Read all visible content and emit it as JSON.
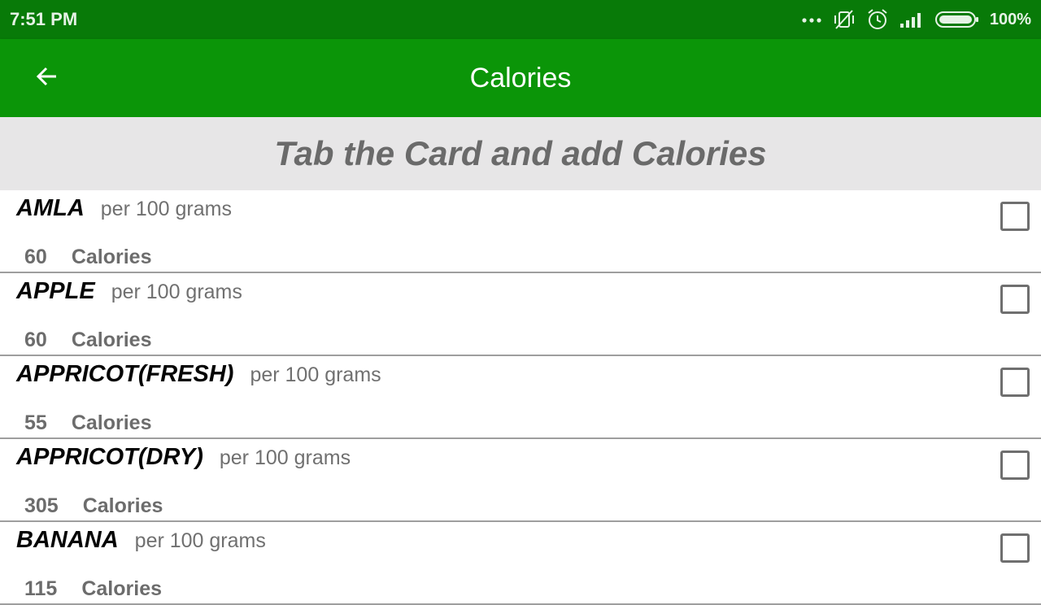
{
  "status_bar": {
    "time": "7:51 PM",
    "battery": "100%",
    "icons": [
      "more-dots-icon",
      "vibrate-off-icon",
      "alarm-icon",
      "signal-icon",
      "battery-icon"
    ]
  },
  "app_bar": {
    "title": "Calories",
    "back_icon": "arrow-back-icon",
    "color": "#0b9508"
  },
  "banner": {
    "text": "Tab the Card and add Calories"
  },
  "foods": [
    {
      "name": "AMLA",
      "unit": "per 100 grams",
      "calories": "60",
      "calories_label": "Calories",
      "checked": false
    },
    {
      "name": "APPLE",
      "unit": "per 100 grams",
      "calories": "60",
      "calories_label": "Calories",
      "checked": false
    },
    {
      "name": "APPRICOT(FRESH)",
      "unit": "per 100 grams",
      "calories": "55",
      "calories_label": "Calories",
      "checked": false
    },
    {
      "name": "APPRICOT(DRY)",
      "unit": "per 100 grams",
      "calories": "305",
      "calories_label": "Calories",
      "checked": false
    },
    {
      "name": "BANANA",
      "unit": "per 100 grams",
      "calories": "115",
      "calories_label": "Calories",
      "checked": false
    }
  ]
}
